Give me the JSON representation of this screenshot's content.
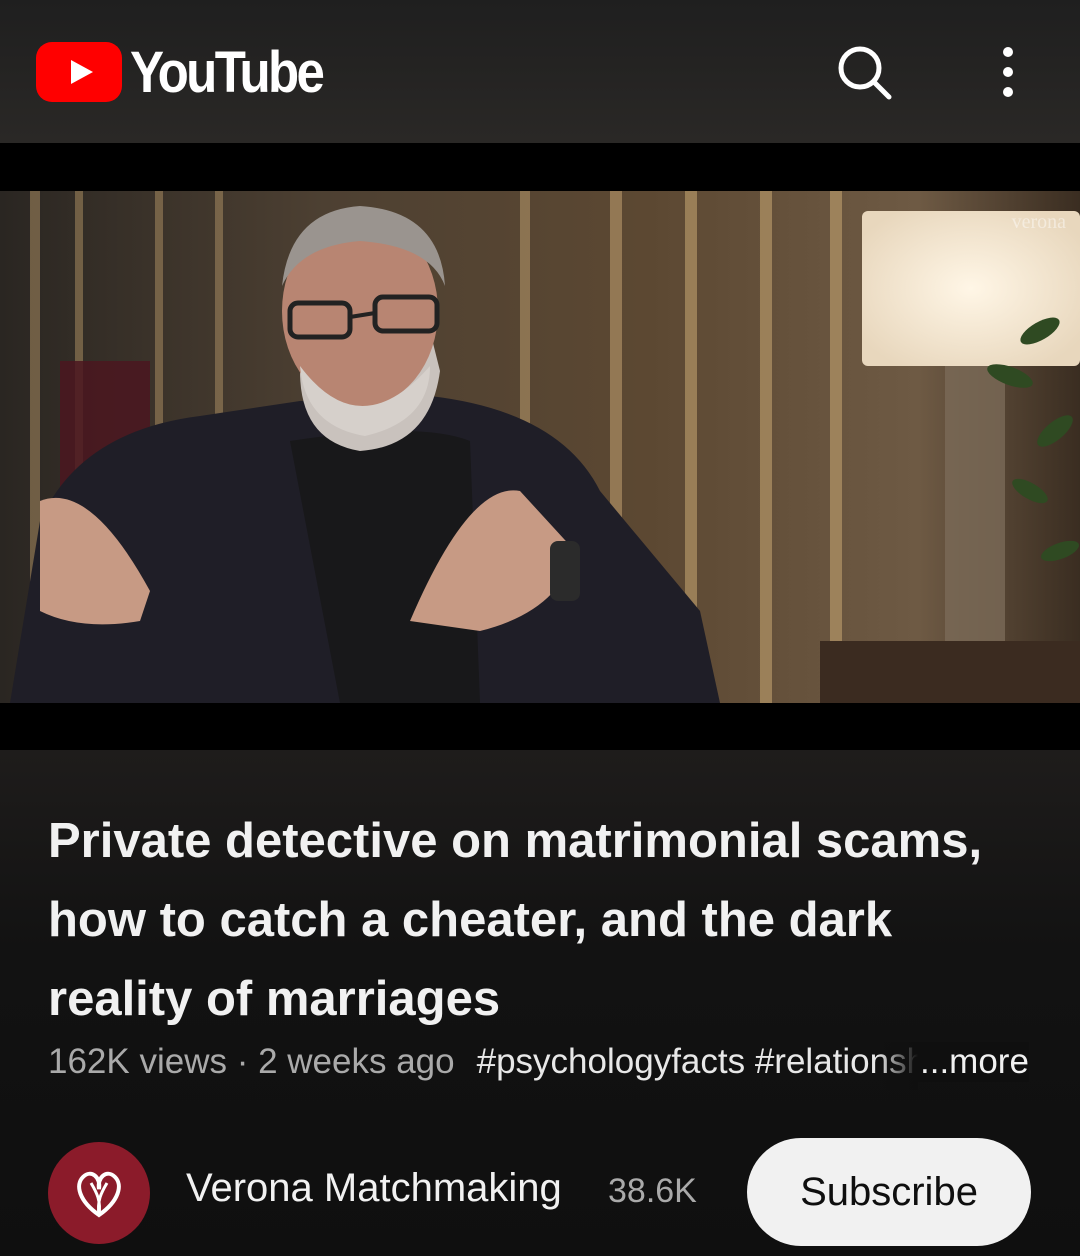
{
  "app": {
    "logo_text": "YouTube",
    "brand_color": "#ff0000",
    "header_icons": [
      "search-icon",
      "more-vert-icon"
    ]
  },
  "player": {
    "watermark": "verona"
  },
  "video": {
    "title": "Private detective on matrimonial scams, how to catch a cheater, and the dark reality of marriages",
    "views": "162K views",
    "separator": " · ",
    "age": "2 weeks ago",
    "hashtags": "#psychologyfacts #relationships",
    "more_label": "...more"
  },
  "channel": {
    "name": "Verona Matchmaking",
    "subscriber_count": "38.6K",
    "avatar_color": "#8b1b2a",
    "subscribe_label": "Subscribe"
  }
}
